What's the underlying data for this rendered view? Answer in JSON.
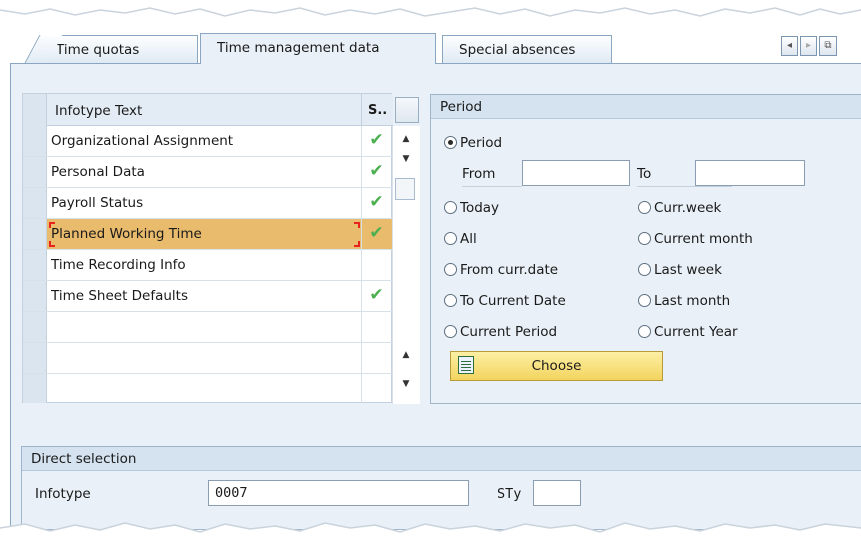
{
  "tabs": [
    {
      "label": "Time quotas",
      "active": false
    },
    {
      "label": "Time management data",
      "active": true
    },
    {
      "label": "Special absences",
      "active": false
    }
  ],
  "tab_nav": {
    "prev": "◂",
    "next": "▸",
    "menu": "⧉"
  },
  "table": {
    "col_text_header": "Infotype Text",
    "col_status_header": "S..",
    "rows": [
      {
        "text": "Organizational Assignment",
        "checked": true,
        "selected": false
      },
      {
        "text": "Personal Data",
        "checked": true,
        "selected": false
      },
      {
        "text": "Payroll Status",
        "checked": true,
        "selected": false
      },
      {
        "text": "Planned Working Time",
        "checked": true,
        "selected": true
      },
      {
        "text": "Time Recording Info",
        "checked": false,
        "selected": false
      },
      {
        "text": "Time Sheet Defaults",
        "checked": true,
        "selected": false
      },
      {
        "text": "",
        "checked": false,
        "selected": false
      },
      {
        "text": "",
        "checked": false,
        "selected": false
      },
      {
        "text": "",
        "checked": false,
        "selected": false
      }
    ],
    "check_glyph": "✔"
  },
  "period": {
    "title": "Period",
    "radio_period": "Period",
    "from_label": "From",
    "from_value": "",
    "to_label": "To",
    "to_value": "",
    "left_options": [
      "Today",
      "All",
      "From curr.date",
      "To Current Date",
      "Current Period"
    ],
    "right_options": [
      "Curr.week",
      "Current month",
      "Last week",
      "Last month",
      "Current Year"
    ],
    "choose_label": "Choose"
  },
  "direct_selection": {
    "title": "Direct selection",
    "infotype_label": "Infotype",
    "infotype_value": "0007",
    "sty_label": "STy",
    "sty_value": ""
  },
  "colors": {
    "selected_row": "#e9bb6c",
    "check": "#4caf50",
    "choose_button": "#f2d45e",
    "panel_bg": "#e9f0f7"
  }
}
